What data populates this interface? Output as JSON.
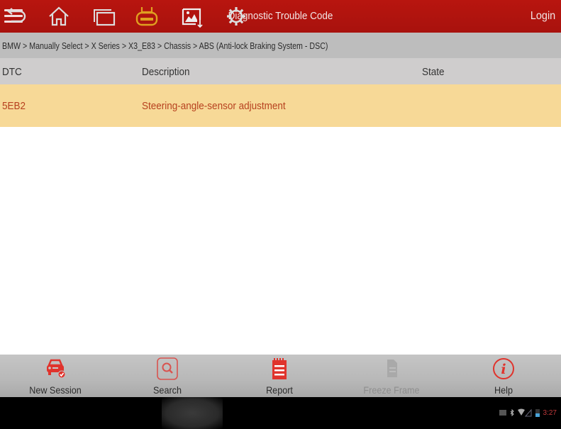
{
  "header": {
    "title": "Diagnostic Trouble Code",
    "login_label": "Login",
    "menu_icon": "hamburger-menu-icon"
  },
  "breadcrumb": "BMW > Manually Select > X Series > X3_E83 > Chassis > ABS (Anti-lock Braking System - DSC)",
  "table": {
    "columns": [
      "DTC",
      "Description",
      "State"
    ],
    "rows": [
      {
        "dtc": "5EB2",
        "description": "Steering-angle-sensor adjustment",
        "state": ""
      }
    ]
  },
  "toolbar": [
    {
      "label": "New Session",
      "icon": "car-check-icon",
      "enabled": true
    },
    {
      "label": "Search",
      "icon": "search-icon",
      "enabled": true
    },
    {
      "label": "Report",
      "icon": "report-notepad-icon",
      "enabled": true
    },
    {
      "label": "Freeze Frame",
      "icon": "freeze-frame-document-icon",
      "enabled": false
    },
    {
      "label": "Help",
      "icon": "info-icon",
      "enabled": true
    }
  ],
  "system_nav": [
    "back-icon",
    "home-icon",
    "recent-apps-icon",
    "launch-app-icon",
    "screenshot-icon",
    "settings-icon"
  ],
  "status_bar": {
    "time": "3:27",
    "icons": [
      "screen-icon",
      "bluetooth-icon",
      "wifi-icon",
      "signal-icon",
      "battery-icon"
    ]
  },
  "colors": {
    "header": "#b0140e",
    "row_highlight": "#f7d997",
    "dtc_text": "#b7411f",
    "accent_red": "#e0332c",
    "launch_orange": "#e0a020",
    "clock": "#c0393b"
  }
}
